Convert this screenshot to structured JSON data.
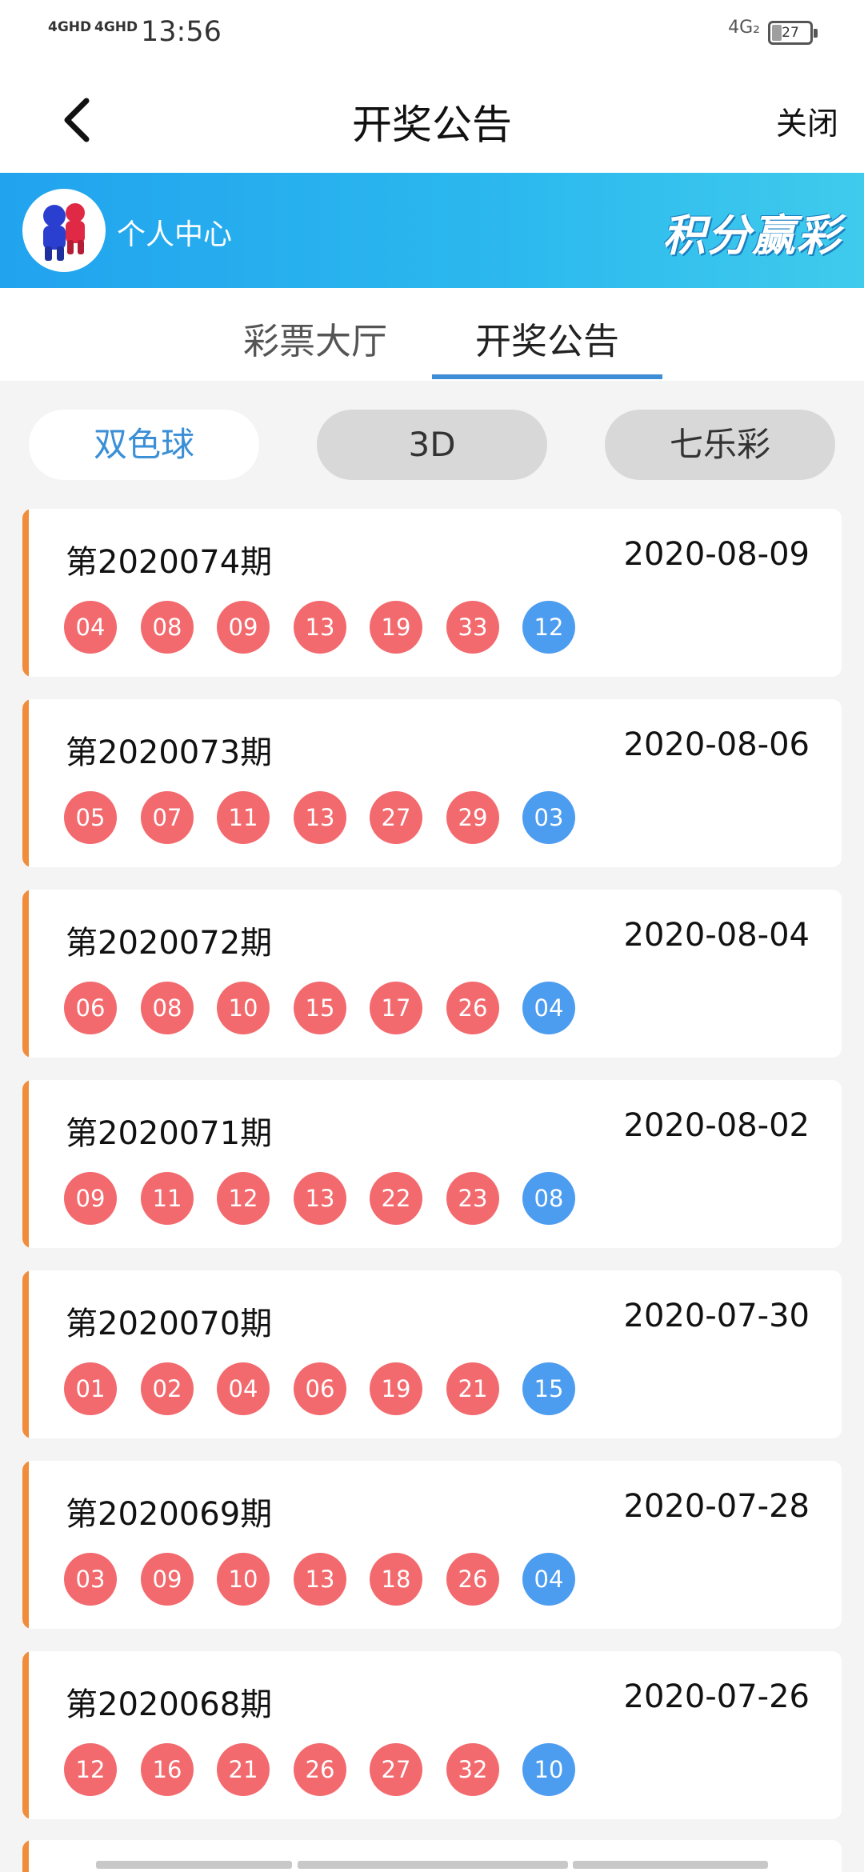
{
  "status": {
    "signal1": "4GHD",
    "signal2": "4GHD",
    "time": "13:56",
    "network": "4G₂",
    "battery": "27"
  },
  "nav": {
    "title": "开奖公告",
    "close_label": "关闭"
  },
  "banner": {
    "label": "个人中心",
    "slogan": "积分赢彩"
  },
  "tabs": [
    {
      "label": "彩票大厅"
    },
    {
      "label": "开奖公告"
    }
  ],
  "active_tab": "开奖公告",
  "categories": [
    {
      "label": "双色球"
    },
    {
      "label": "3D"
    },
    {
      "label": "七乐彩"
    }
  ],
  "selected_category": "双色球",
  "colors": {
    "accent_blue": "#3d8ed6",
    "red_ball": "#f26a6e",
    "blue_ball": "#4c9cf0",
    "card_stripe": "#f08c3a"
  },
  "draws": [
    {
      "issue": "第2020074期",
      "date": "2020-08-09",
      "red": [
        "04",
        "08",
        "09",
        "13",
        "19",
        "33"
      ],
      "blue": "12"
    },
    {
      "issue": "第2020073期",
      "date": "2020-08-06",
      "red": [
        "05",
        "07",
        "11",
        "13",
        "27",
        "29"
      ],
      "blue": "03"
    },
    {
      "issue": "第2020072期",
      "date": "2020-08-04",
      "red": [
        "06",
        "08",
        "10",
        "15",
        "17",
        "26"
      ],
      "blue": "04"
    },
    {
      "issue": "第2020071期",
      "date": "2020-08-02",
      "red": [
        "09",
        "11",
        "12",
        "13",
        "22",
        "23"
      ],
      "blue": "08"
    },
    {
      "issue": "第2020070期",
      "date": "2020-07-30",
      "red": [
        "01",
        "02",
        "04",
        "06",
        "19",
        "21"
      ],
      "blue": "15"
    },
    {
      "issue": "第2020069期",
      "date": "2020-07-28",
      "red": [
        "03",
        "09",
        "10",
        "13",
        "18",
        "26"
      ],
      "blue": "04"
    },
    {
      "issue": "第2020068期",
      "date": "2020-07-26",
      "red": [
        "12",
        "16",
        "21",
        "26",
        "27",
        "32"
      ],
      "blue": "10"
    }
  ]
}
